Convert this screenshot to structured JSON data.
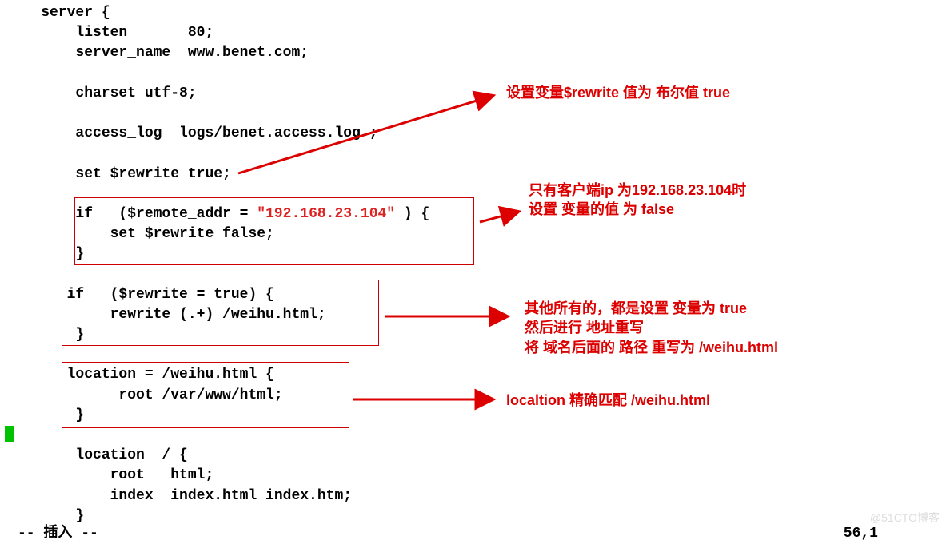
{
  "code": {
    "l1": "    server {",
    "l2": "        listen       80;",
    "l3": "        server_name  www.benet.com;",
    "l4": "",
    "l5": "        charset utf-8;",
    "l6": "",
    "l7": "        access_log  logs/benet.access.log ;",
    "l8": "",
    "l9": "        set $rewrite true;",
    "l10": "",
    "l11a": "        if   ($remote_addr = ",
    "l11b": "\"192.168.23.104\"",
    "l11c": " ) {",
    "l12": "            set $rewrite false;",
    "l13": "        }",
    "l14": "",
    "l15": "       if   ($rewrite = true) {",
    "l16": "            rewrite (.+) /weihu.html;",
    "l17": "        }",
    "l18": "",
    "l19": "       location = /weihu.html {",
    "l20": "             root /var/www/html;",
    "l21": "        }",
    "l22": "",
    "l23": "        location  / {",
    "l24": "            root   html;",
    "l25": "            index  index.html index.htm;",
    "l26": "        }"
  },
  "annotations": {
    "ann1": "设置变量$rewrite 值为 布尔值 true",
    "ann2": "只有客户端ip 为192.168.23.104时\n设置 变量的值 为 false",
    "ann3": "其他所有的，都是设置 变量为 true\n然后进行 地址重写\n将 域名后面的 路径 重写为 /weihu.html",
    "ann4": "localtion 精确匹配 /weihu.html"
  },
  "status": "-- 插入 --",
  "position": "56,1",
  "watermark": "@51CTO博客"
}
